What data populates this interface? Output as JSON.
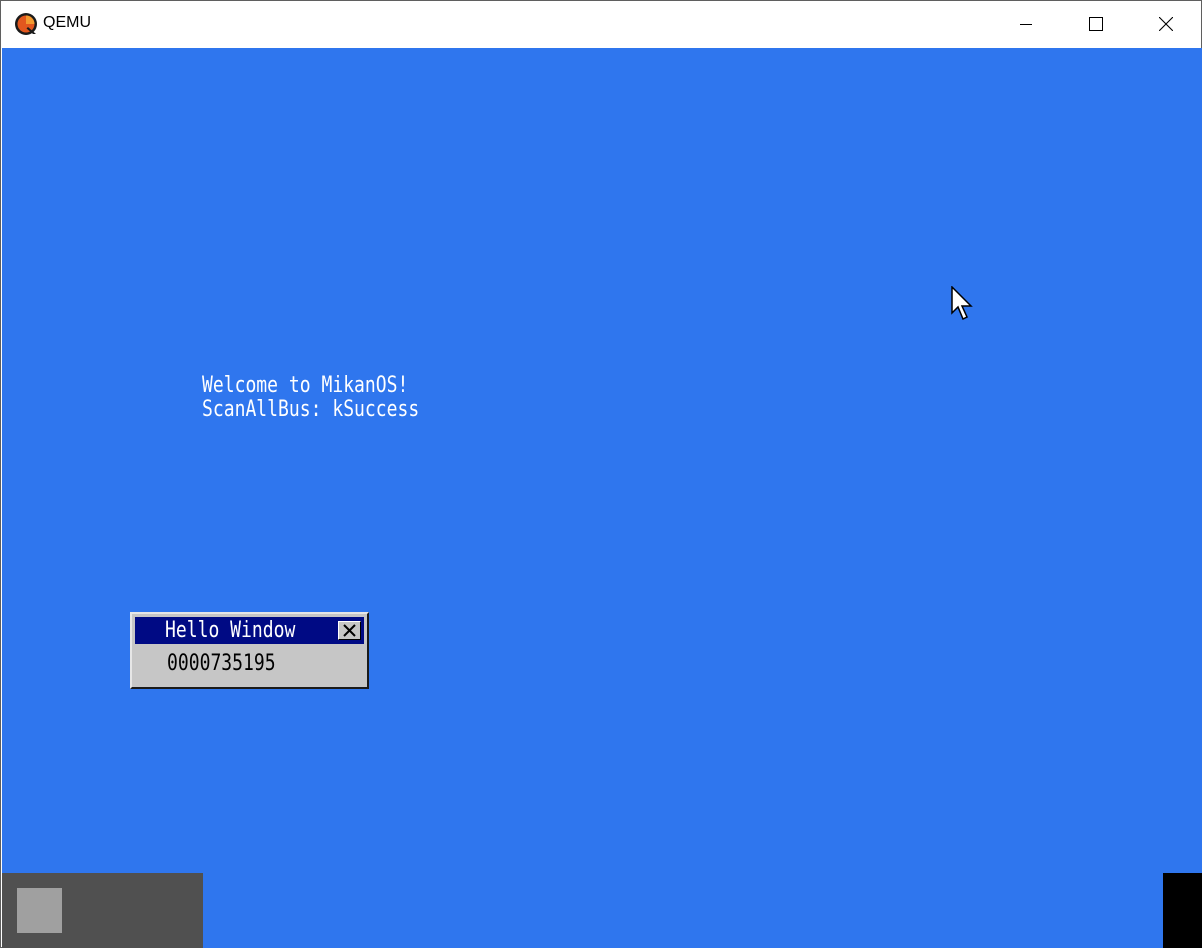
{
  "window": {
    "title": "QEMU",
    "icon": "qemu-logo-icon",
    "controls": {
      "minimize_icon": "minimize-icon",
      "maximize_icon": "maximize-icon",
      "close_icon": "close-icon"
    }
  },
  "desktop": {
    "background_color": "#2f76ee",
    "console": {
      "lines": [
        "Welcome to MikanOS!",
        "ScanAllBus: kSuccess"
      ]
    },
    "cursor_icon": "mouse-pointer-icon",
    "hello_window": {
      "title": "Hello Window",
      "counter": "0000735195",
      "title_color": "#000a84",
      "body_color": "#c6c6c6",
      "close_icon": "close-icon"
    },
    "taskbar": {
      "color": "#505050",
      "start_button_color": "#a0a0a0"
    }
  }
}
